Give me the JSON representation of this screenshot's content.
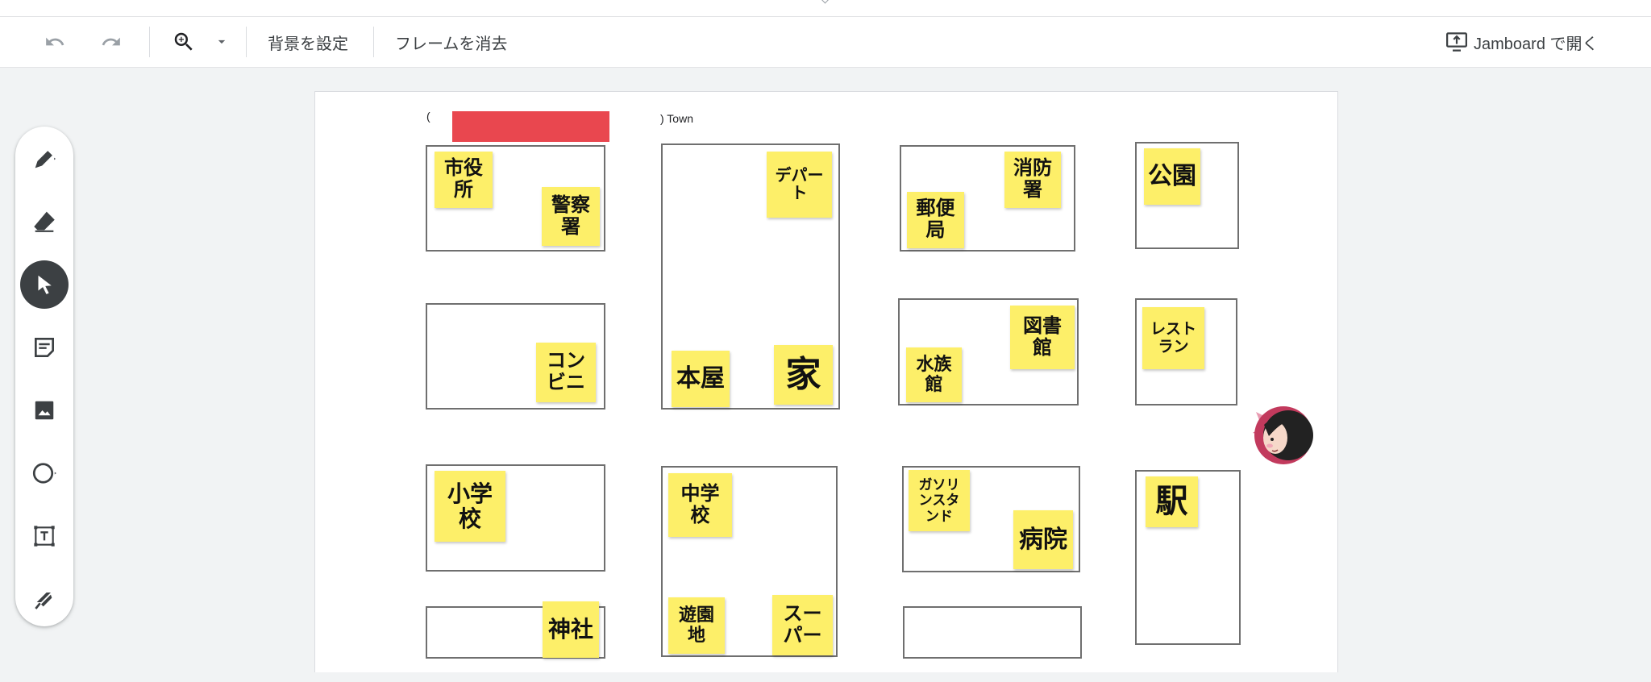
{
  "toolbar": {
    "background_label": "背景を設定",
    "clear_frame_label": "フレームを消去",
    "open_jamboard_label": "Jamboard で開く"
  },
  "palette": {
    "tools": [
      "pen",
      "eraser",
      "select",
      "sticky-note",
      "image",
      "shape",
      "text-box",
      "laser"
    ],
    "active_tool": "select"
  },
  "frame": {
    "title_open_paren": "(",
    "title_suffix": ") Town",
    "notes": {
      "city_hall": "市役\n所",
      "police": "警察\n署",
      "department_store": "デパー\nト",
      "fire_station": "消防\n署",
      "post_office": "郵便\n局",
      "park": "公園",
      "convenience_store": "コン\nビニ",
      "bookstore": "本屋",
      "house": "家",
      "library": "図書\n館",
      "aquarium": "水族\n館",
      "restaurant": "レスト\nラン",
      "elementary_school": "小学\n校",
      "junior_high_school": "中学\n校",
      "gas_station": "ガソリ\nンスタ\nンド",
      "hospital": "病院",
      "station": "駅",
      "shrine": "神社",
      "amusement_park": "遊園\n地",
      "supermarket": "スー\nパー"
    }
  },
  "colors": {
    "sticky_note": "#fdef69",
    "redaction": "#e9474f",
    "active_tool": "#3c4043"
  }
}
